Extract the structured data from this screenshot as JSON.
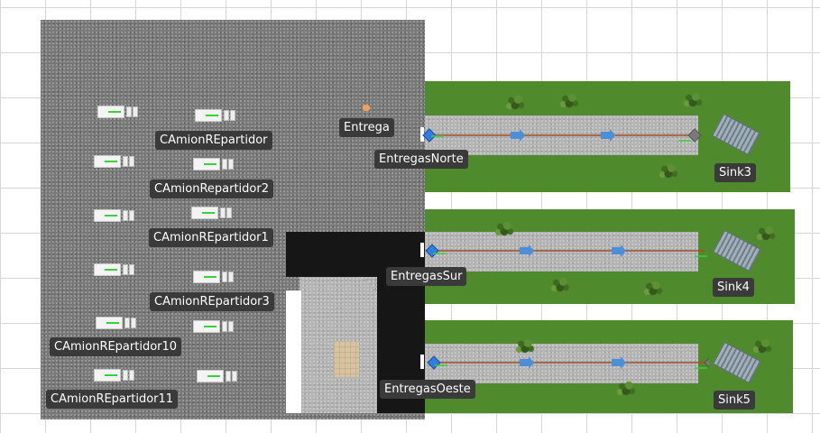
{
  "scene": {
    "source_label": "Entrega",
    "trucks_labels": [
      "CAmionREpartidor",
      "CAmionRepartidor2",
      "CAmionREpartidor1",
      "CAmionREpartidor3",
      "CAmionREpartidor10",
      "CAmionREpartidor11"
    ],
    "conveyors": [
      {
        "label": "EntregasNorte",
        "sink": "Sink3"
      },
      {
        "label": "EntregasSur",
        "sink": "Sink4"
      },
      {
        "label": "EntregasOeste",
        "sink": "Sink5"
      }
    ]
  },
  "colors": {
    "grass": "#4f8a2d",
    "asphalt": "#161616",
    "path_line": "#a0522d",
    "arrow": "#4a8fd8",
    "label_bg": "#3a3a3a"
  },
  "icons": {
    "truck": "truck-icon",
    "conveyor_start": "diamond-icon",
    "conveyor_end": "diamond-gray-icon",
    "direction": "arrow-right-icon",
    "sink": "sink-icon",
    "vegetation": "bush-icon"
  }
}
